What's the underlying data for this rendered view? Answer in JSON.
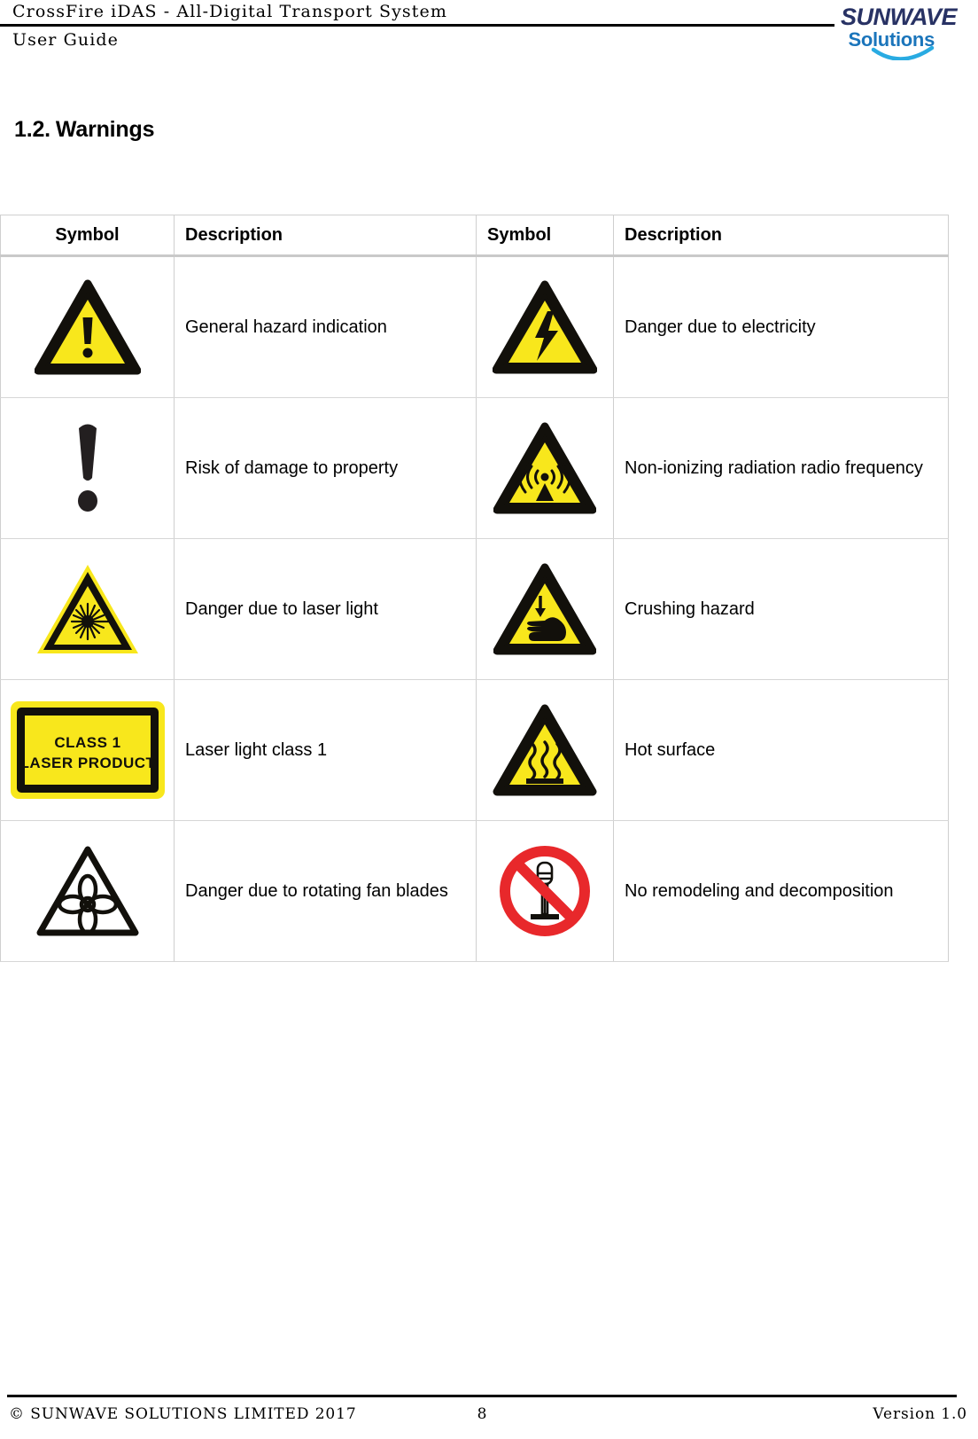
{
  "header": {
    "title_line1": "CrossFire iDAS - All-Digital Transport System",
    "title_line2": "User Guide",
    "logo": {
      "primary_text": "SUNWAVE",
      "secondary_text": "Solutions",
      "primary_color": "#283264",
      "secondary_color": "#1b75bb",
      "swoosh_color": "#29abe2"
    }
  },
  "section": {
    "number": "1.2.",
    "title": "Warnings"
  },
  "table": {
    "headers": {
      "symbol": "Symbol",
      "description": "Description",
      "symbol2": "Symbol",
      "description2": "Description"
    },
    "rows": [
      {
        "left_icon": "general-hazard-triangle-icon",
        "left_desc": "General hazard indication",
        "right_icon": "electricity-hazard-triangle-icon",
        "right_desc": "Danger due to electricity"
      },
      {
        "left_icon": "exclamation-mark-icon",
        "left_desc": "Risk of damage to property",
        "right_icon": "non-ionizing-radiation-triangle-icon",
        "right_desc": "Non-ionizing radiation radio frequency"
      },
      {
        "left_icon": "laser-hazard-triangle-icon",
        "left_desc": "Danger due to laser light",
        "right_icon": "crushing-hazard-triangle-icon",
        "right_desc": "Crushing hazard"
      },
      {
        "left_icon": "class-1-laser-product-label-icon",
        "left_icon_text_line1": "CLASS 1",
        "left_icon_text_line2": "LASER PRODUCT",
        "left_desc": "Laser light class 1",
        "right_icon": "hot-surface-triangle-icon",
        "right_desc": "Hot surface"
      },
      {
        "left_icon": "rotating-fan-blades-triangle-icon",
        "left_desc": "Danger due to rotating fan blades",
        "right_icon": "no-remodeling-prohibition-icon",
        "right_desc": "No remodeling and decomposition"
      }
    ]
  },
  "footer": {
    "copyright": "© SUNWAVE SOLUTIONS LIMITED 2017",
    "page_number": "8",
    "version": "Version 1.0"
  },
  "colors": {
    "hazard_yellow": "#f8e71c",
    "hazard_black": "#12100b",
    "prohibition_red": "#e8282b"
  }
}
